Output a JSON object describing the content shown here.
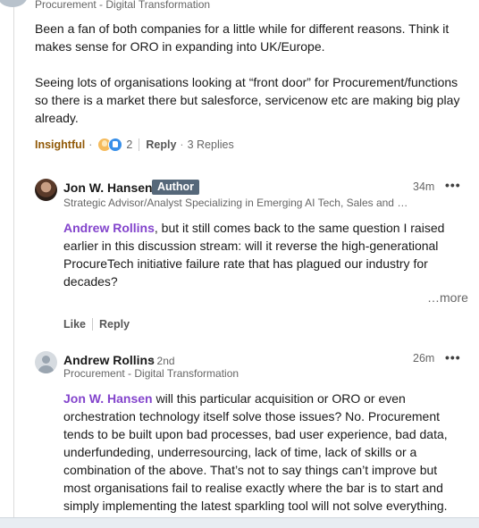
{
  "top_comment": {
    "subtitle": "Procurement - Digital Transformation",
    "body_p1_l1": "Been a fan of both companies for a little while for different reasons. Think it",
    "body_p1_l2": "makes sense for ORO in expanding into UK/Europe.",
    "body_p2_l1": "Seeing lots of organisations looking at “front door” for Procurement/functions",
    "body_p2_l2": "so there is a market there but salesforce, servicenow etc are making big play",
    "body_p2_l3": "already.",
    "reaction_label": "Insightful",
    "reaction_count": "2",
    "reply_label": "Reply",
    "replies_count": "3 Replies",
    "reaction_icons": [
      "insightful-bulb-icon",
      "like-thumb-icon"
    ],
    "colors": {
      "insightful": "#915907",
      "like": "#378fe9"
    }
  },
  "reply1": {
    "author": "Jon W. Hansen",
    "badge": "Author",
    "headline": "Strategic Advisor/Analyst Specializing in Emerging AI Tech, Sales and …",
    "time": "34m",
    "menu": "•••",
    "mention": "Andrew Rollins",
    "line1_rest": ", but it still comes back to the same question I raised",
    "line2": "earlier in this discussion stream: will it reverse the high-generational",
    "line3": "ProcureTech initiative failure rate that has plagued our industry for",
    "line4": "decades?",
    "more_label": "…more",
    "like_label": "Like",
    "reply_label": "Reply"
  },
  "reply2": {
    "author": "Andrew Rollins",
    "degree": "• 2nd",
    "headline": "Procurement - Digital Transformation",
    "time": "26m",
    "menu": "•••",
    "mention": "Jon W. Hansen",
    "line1_rest": " will this particular acquisition or ORO or even",
    "line2": "orchestration technology itself solve those issues? No. Procurement",
    "line3": "tends to be built upon bad processes, bad user experience, bad data,",
    "line4": "underfundeding, underresourcing, lack of time, lack of skills or a",
    "line5": "combination of the above. That’s not to say things can’t improve but",
    "line6": "most organisations fail to realise exactly where the bar is to start and",
    "line7": "simply implementing the latest sparkling tool will not solve everything."
  },
  "colors": {
    "mention": "#8344cc",
    "author_badge": "#56687a",
    "text": "#191919",
    "muted": "#666666"
  }
}
